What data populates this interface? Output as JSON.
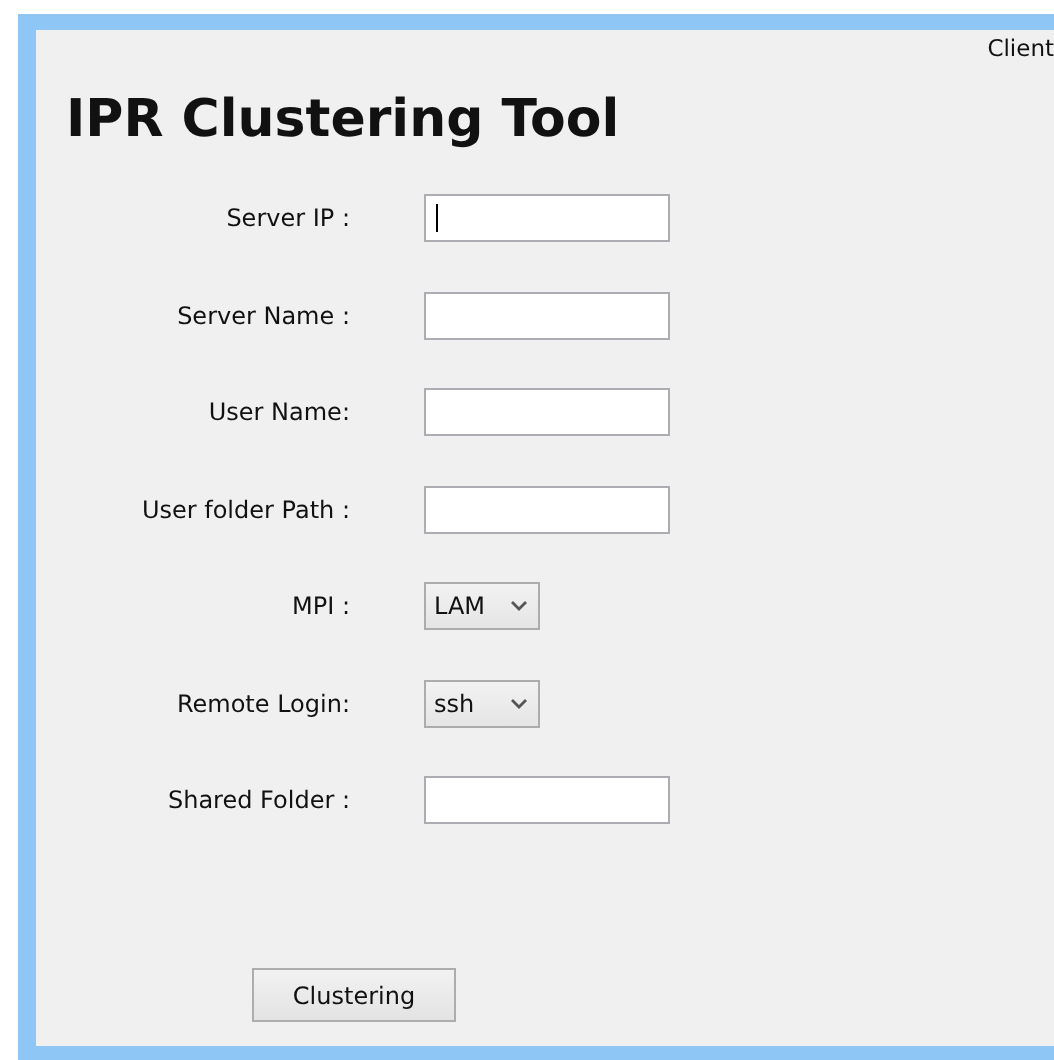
{
  "header": {
    "corner_text": "Client",
    "title": "IPR Clustering Tool"
  },
  "fields": [
    {
      "label": "Server IP :",
      "kind": "text",
      "focused": true
    },
    {
      "label": "Server Name :",
      "kind": "text",
      "focused": false
    },
    {
      "label": "User Name:",
      "kind": "text",
      "focused": false
    },
    {
      "label": "User folder Path :",
      "kind": "text",
      "focused": false
    },
    {
      "label": "MPI :",
      "kind": "select",
      "value": "LAM"
    },
    {
      "label": "Remote Login:",
      "kind": "select",
      "value": "ssh"
    },
    {
      "label": "Shared Folder :",
      "kind": "text",
      "focused": false
    }
  ],
  "button": "Clustering"
}
